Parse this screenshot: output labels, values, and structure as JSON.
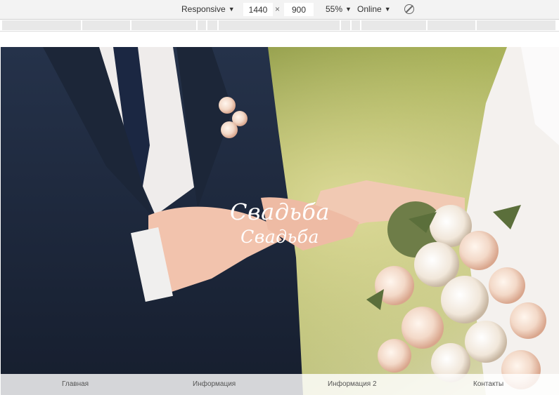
{
  "device_toolbar": {
    "device_label": "Responsive",
    "width_value": "1440",
    "times_sign": "×",
    "height_value": "900",
    "zoom_label": "55%",
    "network_label": "Online",
    "rotate_icon": "rotate-disabled-icon"
  },
  "hero": {
    "title": "Свадьба",
    "subtitle": "Свадьба"
  },
  "nav": {
    "items": [
      {
        "label": "Главная"
      },
      {
        "label": "Информация"
      },
      {
        "label": "Информация 2"
      },
      {
        "label": "Контакты"
      }
    ]
  },
  "colors": {
    "toolbar_bg": "#f3f3f3",
    "nav_bg": "rgba(255,255,255,0.82)",
    "title": "#ffffff"
  }
}
